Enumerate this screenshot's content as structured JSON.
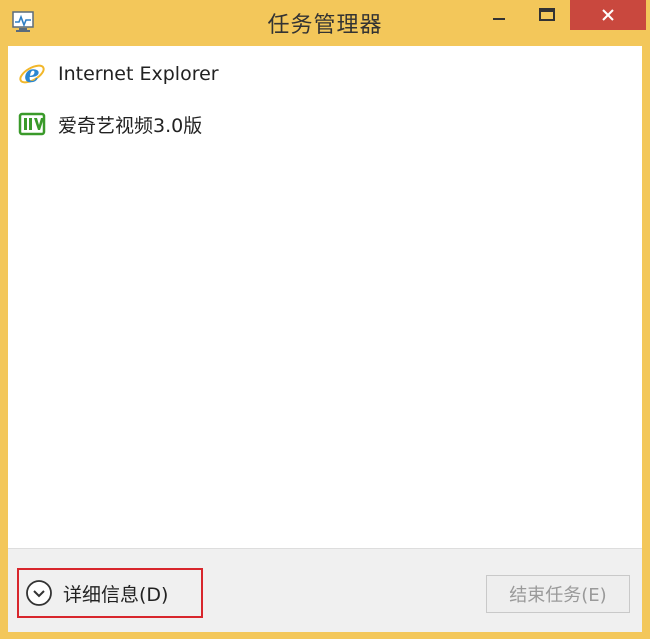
{
  "window": {
    "title": "任务管理器",
    "accent_color": "#f3c75a",
    "close_color": "#c9483e",
    "controls": {
      "minimize_icon": "minimize-icon",
      "maximize_icon": "maximize-icon",
      "close_icon": "close-icon"
    }
  },
  "apps": [
    {
      "label": "Internet Explorer",
      "icon": "internet-explorer-icon"
    },
    {
      "label": "爱奇艺视频3.0版",
      "icon": "iqiyi-icon"
    }
  ],
  "footer": {
    "details_label": "详细信息(D)",
    "details_icon": "chevron-down-circle-icon",
    "end_task_label": "结束任务(E)",
    "highlight_color": "#d8262c"
  }
}
